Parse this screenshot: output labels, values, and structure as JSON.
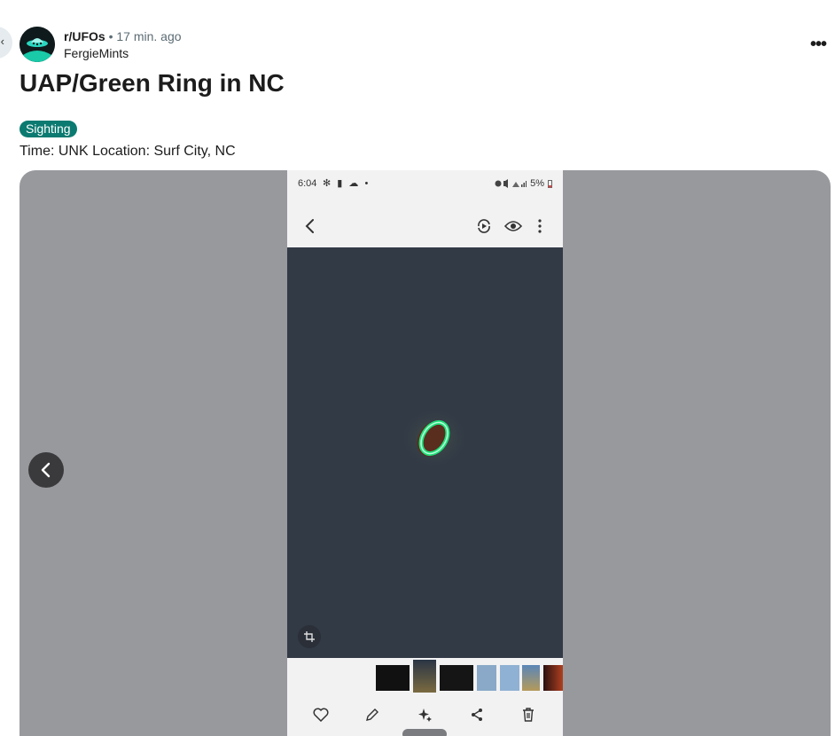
{
  "post": {
    "subreddit": "r/UFOs",
    "separator": "•",
    "time": "17 min. ago",
    "author": "FergieMints",
    "more_label": "•••",
    "title": "UAP/Green Ring in NC",
    "flair": "Sighting",
    "body": "Time: UNK Location: Surf City, NC"
  },
  "screenshot": {
    "status_time": "6:04",
    "status_left_icons": "✻ ▮ ☁ •",
    "battery": "5%"
  },
  "icons": {
    "back_nav": "chevron-left-icon",
    "more": "more-horizontal-icon",
    "prev": "chevron-left-icon",
    "phone_back": "arrow-back-icon",
    "motion_photo": "motion-photo-icon",
    "view": "eye-icon",
    "phone_more": "more-vertical-icon",
    "crop": "crop-icon",
    "favorite": "heart-icon",
    "edit": "pencil-icon",
    "ai_edit": "sparkle-icon",
    "share": "share-icon",
    "delete": "trash-icon"
  },
  "colors": {
    "flair_bg": "#0b7a70",
    "media_bg": "#98999d",
    "photo_sky": "#323a46",
    "ring_green": "#1fe07a"
  }
}
